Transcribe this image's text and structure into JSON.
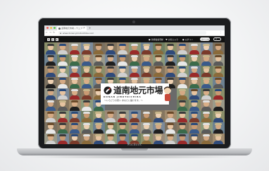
{
  "device": {
    "brand": "MacBook"
  },
  "browser": {
    "tab_title": "道南地元市場 | ウェブ...",
    "tab_close": "×",
    "tab_new": "+",
    "back_icon": "←",
    "forward_icon": "→",
    "reload_icon": "↻",
    "url": "www.donan-jimotoichiba.com",
    "menu_icon": "⋮"
  },
  "site_nav": {
    "facebook": "f",
    "instagram": "◎",
    "line": "L",
    "links": [
      {
        "icon": "user-icon",
        "glyph": "●",
        "label": "新規会員登録"
      },
      {
        "icon": "heart-icon",
        "glyph": "♥",
        "label": "お気に入り"
      },
      {
        "icon": "login-icon",
        "glyph": "●",
        "label": "ログイン"
      }
    ],
    "cart_label": "カート 0",
    "menu_label": "≡"
  },
  "hero": {
    "logo_title": "道南地元市場",
    "logo_romaji": "DONAN   JIMOTOICHIBA",
    "tagline": "〜いろどりの想い あなたに届けます。〜"
  },
  "colors": {
    "nav_bg": "#121212",
    "accent_red": "#d33a2c"
  }
}
